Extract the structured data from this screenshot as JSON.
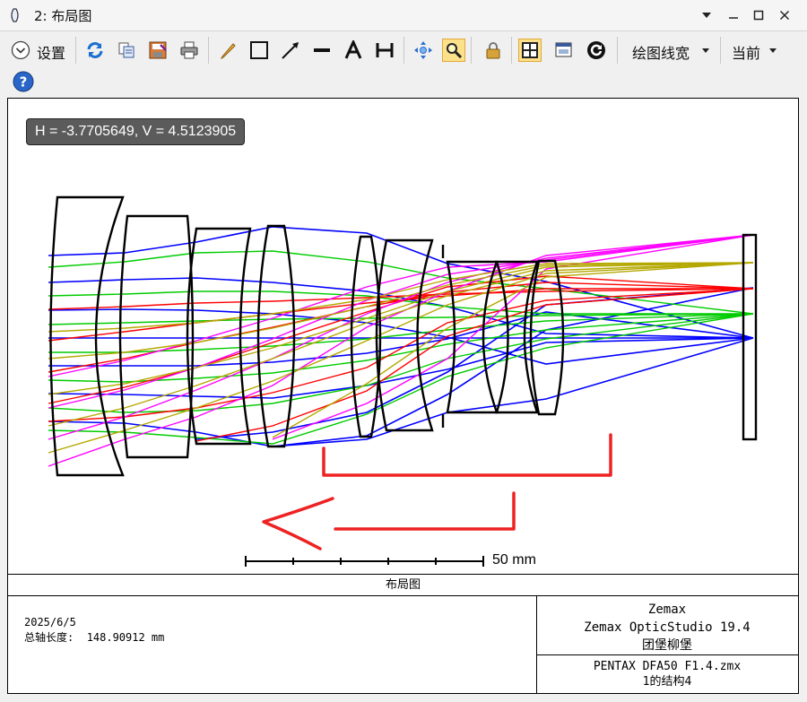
{
  "window": {
    "title": "2: 布局图"
  },
  "toolbar": {
    "settings_label": "设置",
    "linewidth_label": "绘图线宽",
    "current_label": "当前"
  },
  "plot": {
    "coord_readout": "H = -3.7705649, V = 4.5123905",
    "scale_label": "50 mm",
    "caption": "布局图",
    "date": "2025/6/5",
    "axis_length_label": "总轴长度:",
    "axis_length_value": "148.90912 mm",
    "software_line1": "Zemax",
    "software_line2": "Zemax OpticStudio 19.4",
    "software_line3": "团堡柳堡",
    "file_name": "PENTAX DFA50 F1.4.zmx",
    "config_label": "1的结构4"
  },
  "colors": {
    "accent": "#fde08a",
    "ray_blue": "#0000ff",
    "ray_green": "#00cc00",
    "ray_red": "#ff0000",
    "ray_magenta": "#ff00ff",
    "ray_olive": "#b4a800",
    "annotation_red": "#ee2222"
  }
}
